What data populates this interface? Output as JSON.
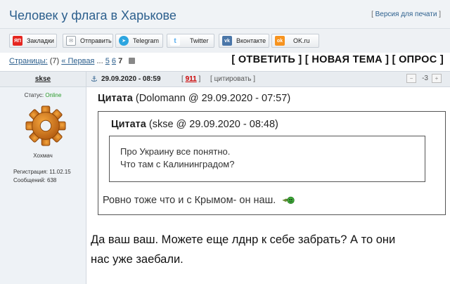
{
  "header": {
    "title": "Человек у флага в Харькове",
    "print_link": "Версия для печати",
    "print_open": "[ ",
    "print_close": " ]"
  },
  "share": [
    {
      "label": "Закладки",
      "icon": "yandex-bookmark-icon",
      "color": "#e52620",
      "glyph": "ЯП"
    },
    {
      "label": "Отправить",
      "icon": "envelope-icon",
      "color": "#9aa3ab",
      "glyph": "✉"
    },
    {
      "label": "Telegram",
      "icon": "telegram-icon",
      "color": "#2ca5e0",
      "glyph": "➤"
    },
    {
      "label": "Twitter",
      "icon": "twitter-icon",
      "color": "#9bc8e6",
      "glyph": "t"
    },
    {
      "label": "Вконтакте",
      "icon": "vk-icon",
      "color": "#4a76a8",
      "glyph": "vk"
    },
    {
      "label": "OK.ru",
      "icon": "odnoklassniki-icon",
      "color": "#f7931e",
      "glyph": "ok"
    }
  ],
  "pager": {
    "label": "Страницы:",
    "count": "(7)",
    "first": "« Первая",
    "ellipsis": "...",
    "pages": [
      "5",
      "6",
      "7"
    ],
    "current": "7"
  },
  "actions": {
    "reply": "ОТВЕТИТЬ",
    "new_topic": "НОВАЯ ТЕМА",
    "poll": "ОПРОС"
  },
  "post": {
    "author": "skse",
    "date": "29.09.2020 - 08:59",
    "number": "911",
    "cite": "цитировать",
    "score": "-3",
    "status_label": "Статус:",
    "status_value": "Online",
    "role": "Хохмач",
    "registration": "Регистрация: 11.02.15",
    "messages": "Сообщений: 638"
  },
  "quote_outer": {
    "label": "Цитата",
    "meta": "(Dolomann @ 29.09.2020 - 07:57)",
    "text": "Ровно тоже что и с Крымом- он наш."
  },
  "quote_inner": {
    "label": "Цитата",
    "meta": "(skse @ 29.09.2020 - 08:48)",
    "line1": "Про Украину все понятно.",
    "line2": "Что там с Калининградом?"
  },
  "body_text": "Да ваш ваш. Можете еще лднр к себе забрать? А то они нас уже заебали.",
  "colors": {
    "accent": "#2c5f8d",
    "online": "#2a9a2a",
    "post_number": "#cc0000"
  }
}
